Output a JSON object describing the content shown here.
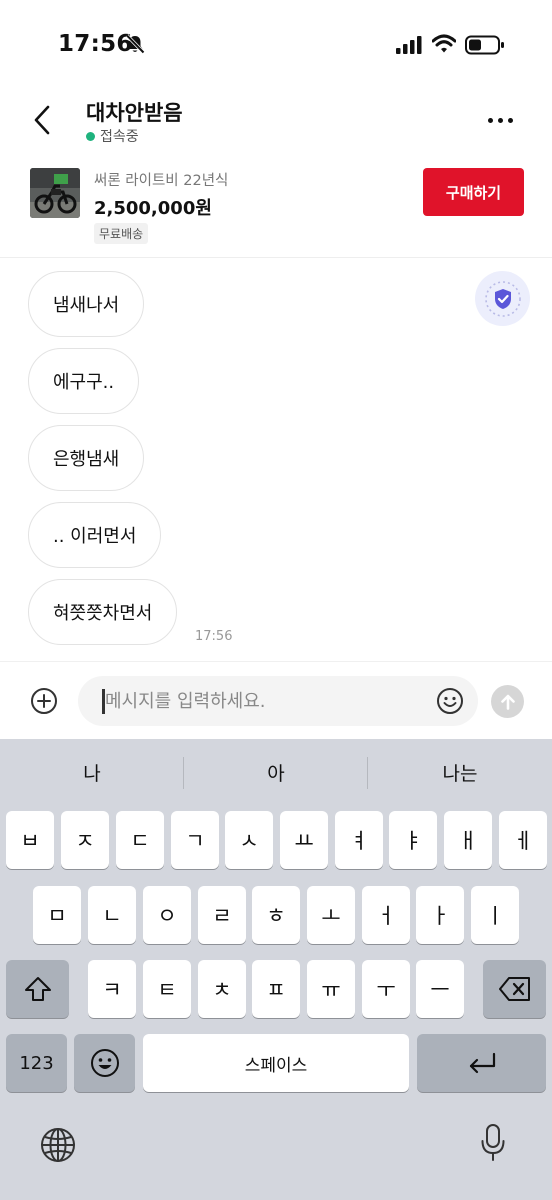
{
  "status_bar": {
    "time": "17:56"
  },
  "header": {
    "title": "대차안받음",
    "status": "접속중"
  },
  "product": {
    "name": "써론 라이트비 22년식",
    "price": "2,500,000원",
    "tag": "무료배송",
    "buy_label": "구매하기"
  },
  "chat": {
    "messages": [
      "냄새나서",
      "에구구..",
      "은행냄새",
      ".. 이러면서",
      "혀쯧쯧차면서"
    ],
    "last_time": "17:56"
  },
  "input": {
    "placeholder": "메시지를 입력하세요.",
    "value": ""
  },
  "keyboard": {
    "suggestions": [
      "나",
      "아",
      "나는"
    ],
    "row1": [
      "ㅂ",
      "ㅈ",
      "ㄷ",
      "ㄱ",
      "ㅅ",
      "ㅛ",
      "ㅕ",
      "ㅑ",
      "ㅐ",
      "ㅔ"
    ],
    "row2": [
      "ㅁ",
      "ㄴ",
      "ㅇ",
      "ㄹ",
      "ㅎ",
      "ㅗ",
      "ㅓ",
      "ㅏ",
      "ㅣ"
    ],
    "row3": [
      "ㅋ",
      "ㅌ",
      "ㅊ",
      "ㅍ",
      "ㅠ",
      "ㅜ",
      "ㅡ"
    ],
    "num_key": "123",
    "space_key": "스페이스"
  },
  "colors": {
    "buy": "#e0132a",
    "online": "#1fb37e",
    "keyboard_bg": "#d3d6dd",
    "shield": "#5b57d9"
  },
  "icons": [
    "back-icon",
    "more-icon",
    "shield-check-icon",
    "plus-circle-icon",
    "emoji-icon",
    "send-arrow-icon",
    "shift-icon",
    "backspace-icon",
    "return-icon",
    "globe-icon",
    "mic-icon"
  ]
}
